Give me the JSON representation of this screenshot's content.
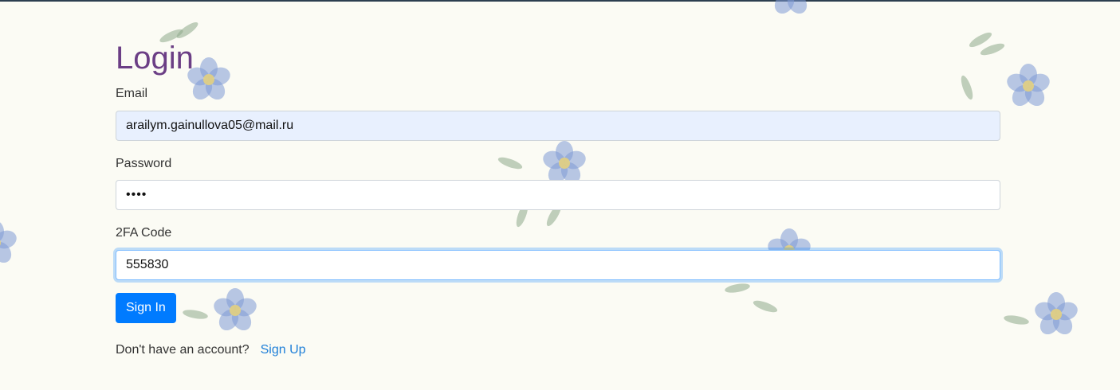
{
  "page": {
    "title": "Login"
  },
  "form": {
    "email_label": "Email",
    "email_value": "arailym.gainullova05@mail.ru",
    "password_label": "Password",
    "password_value": "••••",
    "twofa_label": "2FA Code",
    "twofa_value": "555830",
    "submit_label": "Sign In"
  },
  "footer": {
    "prompt": "Don't have an account?",
    "link_label": "Sign Up"
  },
  "colors": {
    "title": "#6b3e85",
    "primary": "#007bff",
    "link": "#1e7fd8",
    "autofill_bg": "#e8f0fe",
    "page_bg": "#fbfbf4",
    "flower": "#7f9bd6",
    "leaf": "#8ea98a"
  },
  "decor": {
    "background_pattern": "forget-me-not-flowers"
  }
}
